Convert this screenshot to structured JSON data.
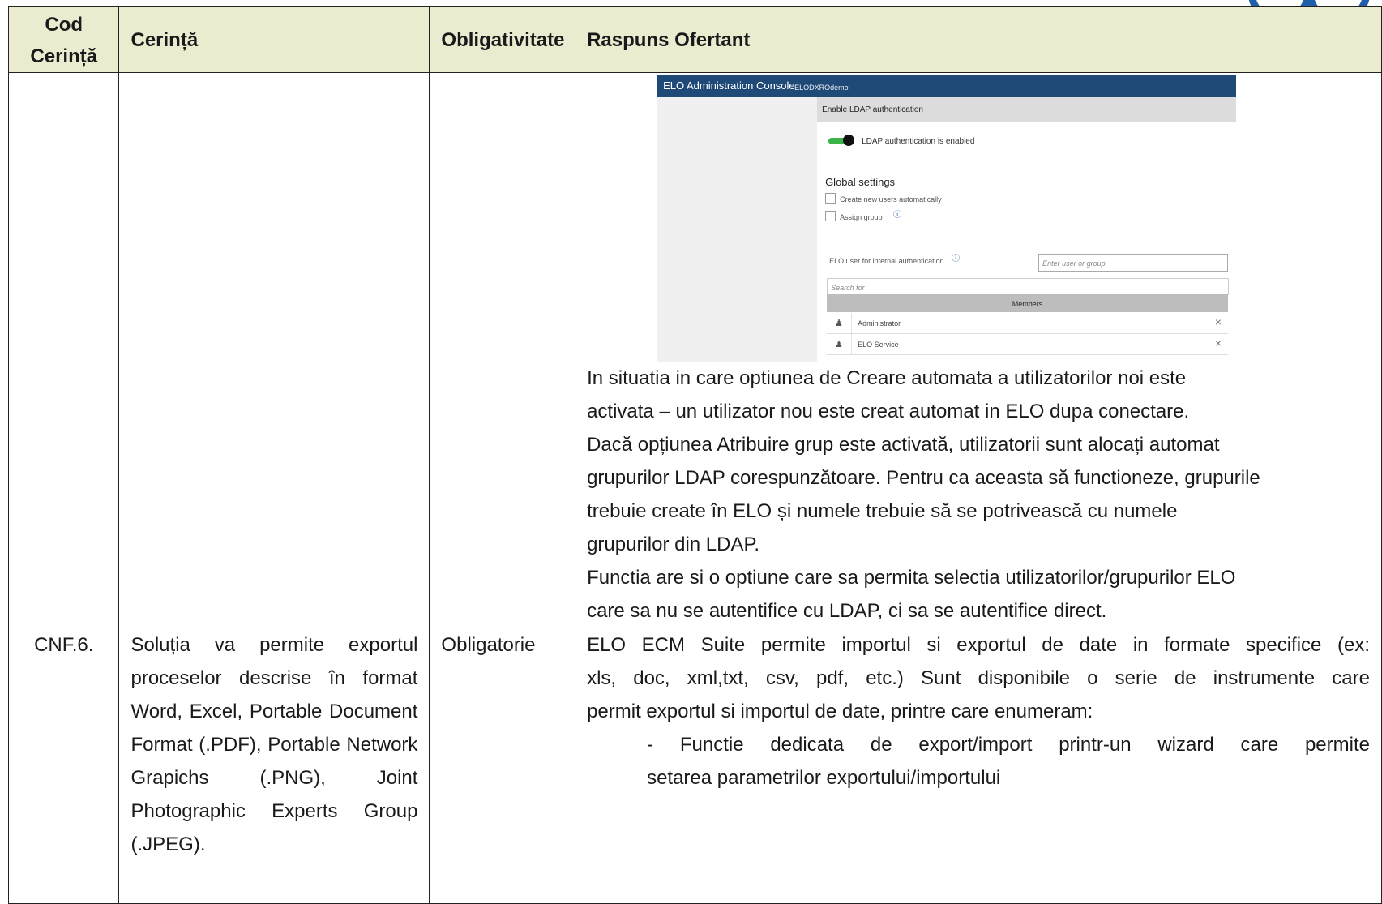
{
  "header": {
    "col_code": "Cod Cerință",
    "col_requirement": "Cerință",
    "col_mandatory": "Obligativitate",
    "col_response": "Raspuns Ofertant"
  },
  "embedded_screenshot": {
    "app_title": "ELO Administration Console",
    "instance": "ELODXROdemo",
    "section_header": "Enable LDAP authentication",
    "toggle_label": "LDAP authentication is enabled",
    "global_settings": "Global settings",
    "checkbox_create_users": "Create new users automatically",
    "checkbox_assign_group": "Assign group",
    "internal_auth_label": "ELO user for internal authentication",
    "user_input_placeholder": "Enter user or group",
    "search_placeholder": "Search for",
    "members_header": "Members",
    "members": [
      "Administrator",
      "ELO Service"
    ]
  },
  "row1": {
    "response_lines": [
      "In situatia in care optiunea de Creare automata a utilizatorilor noi este",
      "activata – un utilizator nou este creat automat in ELO dupa conectare.",
      "Dacă opțiunea Atribuire grup este activată, utilizatorii sunt alocați automat",
      "grupurilor LDAP corespunzătoare. Pentru ca aceasta să functioneze, grupurile",
      "trebuie create în ELO și numele trebuie să se potrivească cu numele",
      "grupurilor din LDAP.",
      "Functia are si o optiune care sa permita selectia utilizatorilor/grupurilor ELO",
      "care sa nu se autentifice cu LDAP, ci sa se autentifice direct."
    ]
  },
  "row2": {
    "code": "CNF.6.",
    "requirement_lines": [
      "Soluția va permite exportul",
      "proceselor descrise în format",
      "Word, Excel, Portable Document",
      "Format (.PDF), Portable Network",
      "Grapichs (.PNG), Joint",
      "Photographic Experts Group",
      "(.JPEG)."
    ],
    "mandatory": "Obligatorie",
    "response_lines": [
      "ELO ECM Suite permite importul si exportul de date in formate specifice (ex:",
      "xls, doc, xml,txt, csv, pdf, etc.) Sunt disponibile o serie de instrumente care",
      "permit exportul si importul de date, printre care enumeram:",
      "- Functie dedicata de export/import printr-un wizard care permite",
      "setarea parametrilor exportului/importului"
    ]
  }
}
